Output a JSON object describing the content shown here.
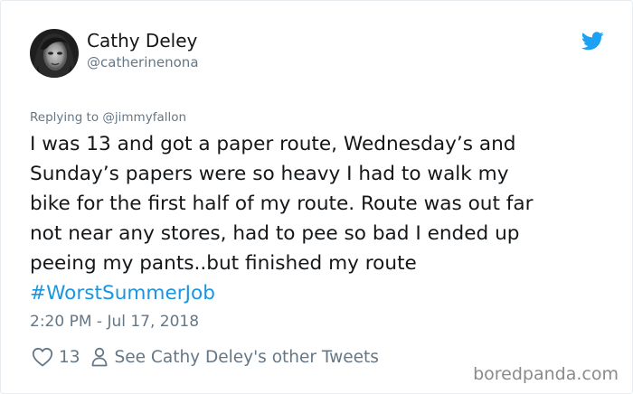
{
  "author": {
    "name": "Cathy Deley",
    "handle": "@catherinenona"
  },
  "tweet": {
    "replying_to": "Replying to @jimmyfallon",
    "lines": [
      "I was 13 and got a paper route, Wednesday’s and",
      "Sunday’s papers were so heavy I had to walk my",
      "bike for the first half of my route. Route was out far",
      "not near any stores, had to pee so bad I ended up",
      "peeing my pants..but finished my route"
    ],
    "hashtag": "#WorstSummerJob",
    "timestamp": "2:20 PM - Jul 17, 2018"
  },
  "actions": {
    "like_count": "13",
    "other_tweets_label": "See Cathy Deley's other Tweets"
  },
  "watermark": "boredpanda.com",
  "icons": {
    "brand": "twitter-bird-icon",
    "like": "heart-icon",
    "profile": "person-icon"
  },
  "colors": {
    "text": "#14171a",
    "secondary": "#657786",
    "link": "#1b95e0",
    "twitter_blue": "#1da1f2",
    "card_border": "#e6ecf0"
  }
}
